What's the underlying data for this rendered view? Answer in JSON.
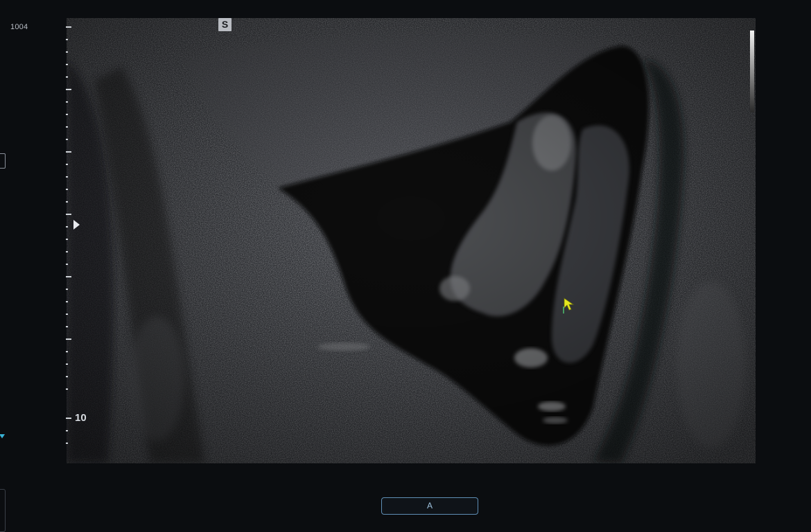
{
  "frame": {
    "id_label": "1004"
  },
  "probe_badge": {
    "label": "S"
  },
  "depth_scale": {
    "major_label": "10"
  },
  "bottom_button": {
    "label": "A"
  },
  "colors": {
    "background": "#0b0d10",
    "scale_ticks": "#cfd3d8",
    "button_border": "#5f8fb6",
    "cursor": "#e6e81e",
    "side_marker": "#39b3d6"
  },
  "icons": {
    "cursor": "pointer-arrow-icon",
    "focus": "focus-triangle-icon",
    "side_marker": "chevron-down-icon"
  }
}
